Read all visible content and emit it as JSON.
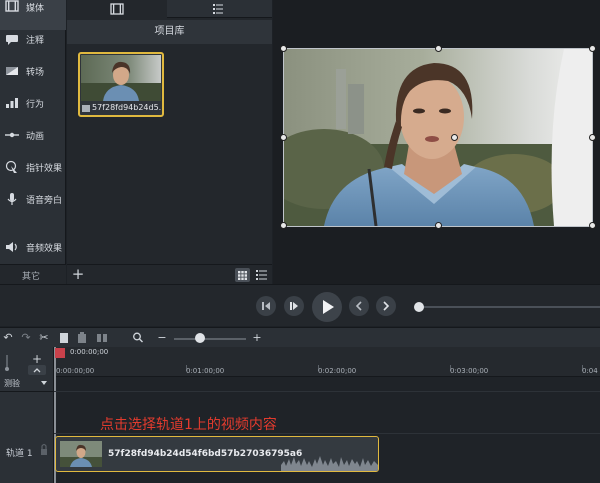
{
  "sidebar": {
    "items": [
      {
        "label": "媒体",
        "icon": "film-icon"
      },
      {
        "label": "注释",
        "icon": "annotation-icon"
      },
      {
        "label": "转场",
        "icon": "transition-icon"
      },
      {
        "label": "行为",
        "icon": "behavior-icon"
      },
      {
        "label": "动画",
        "icon": "animation-icon"
      },
      {
        "label": "指针效果",
        "icon": "cursor-effect-icon"
      },
      {
        "label": "语音旁白",
        "icon": "microphone-icon"
      },
      {
        "label": "音频效果",
        "icon": "speaker-icon"
      }
    ],
    "more_label": "其它"
  },
  "bin": {
    "title": "项目库",
    "media_name": "57f28fd94b24d5..."
  },
  "timeline": {
    "playhead_time": "0:00:00;00",
    "ruler_labels": [
      "0:00:00;00",
      "0:01:00;00",
      "0:02:00;00",
      "0:03:00;00",
      "0:04"
    ],
    "measure_label": "测验",
    "track_label": "轨道 1",
    "clip_name": "57f28fd94b24d54f6bd57b27036795a6",
    "annotation": "点击选择轨道1上的视频内容"
  },
  "colors": {
    "selection": "#e0b93f",
    "annotation": "#e23b2e",
    "playhead": "#c9414b"
  }
}
